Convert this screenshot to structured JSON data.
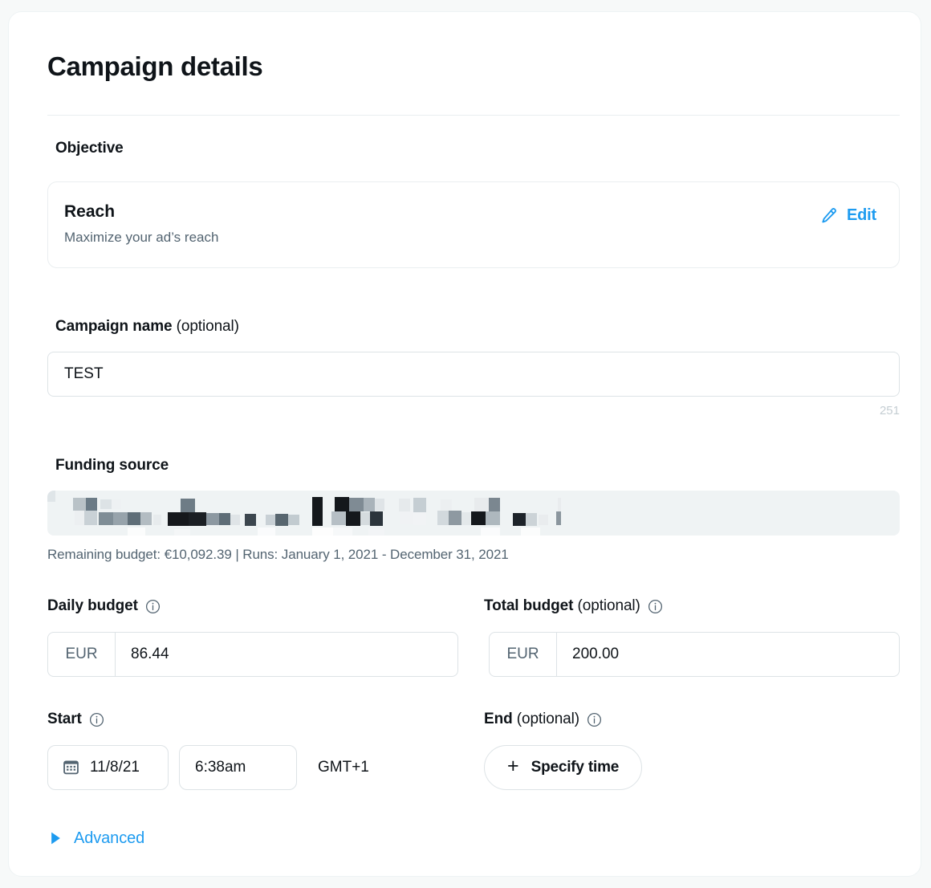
{
  "page": {
    "title": "Campaign details",
    "background_color": "#f7f9f9",
    "card_color": "#ffffff",
    "accent_color": "#1d9bf0",
    "text_color": "#0f1419",
    "muted_text_color": "#536471"
  },
  "objective": {
    "section_label": "Objective",
    "name": "Reach",
    "description": "Maximize your ad’s reach",
    "edit_label": "Edit",
    "edit_icon": "pencil-icon"
  },
  "campaign_name": {
    "label": "Campaign name",
    "optional_suffix": " (optional)",
    "value": "TEST",
    "char_count": "251"
  },
  "funding_source": {
    "label": "Funding source",
    "value_redacted": true,
    "helper_text": "Remaining budget: €10,092.39 | Runs: January 1, 2021 - December 31, 2021"
  },
  "daily_budget": {
    "label": "Daily budget",
    "optional_suffix": "",
    "info_icon": "info-icon",
    "currency": "EUR",
    "value": "86.44"
  },
  "total_budget": {
    "label": "Total budget",
    "optional_suffix": " (optional)",
    "info_icon": "info-icon",
    "currency": "EUR",
    "value": "200.00"
  },
  "start": {
    "label": "Start",
    "info_icon": "info-icon",
    "calendar_icon": "calendar-icon",
    "date": "11/8/21",
    "time": "6:38am",
    "timezone": "GMT+1"
  },
  "end": {
    "label": "End",
    "optional_suffix": " (optional)",
    "info_icon": "info-icon",
    "specify_plus": "+",
    "specify_label": "Specify time"
  },
  "advanced": {
    "label": "Advanced",
    "icon": "triangle-right-icon"
  }
}
